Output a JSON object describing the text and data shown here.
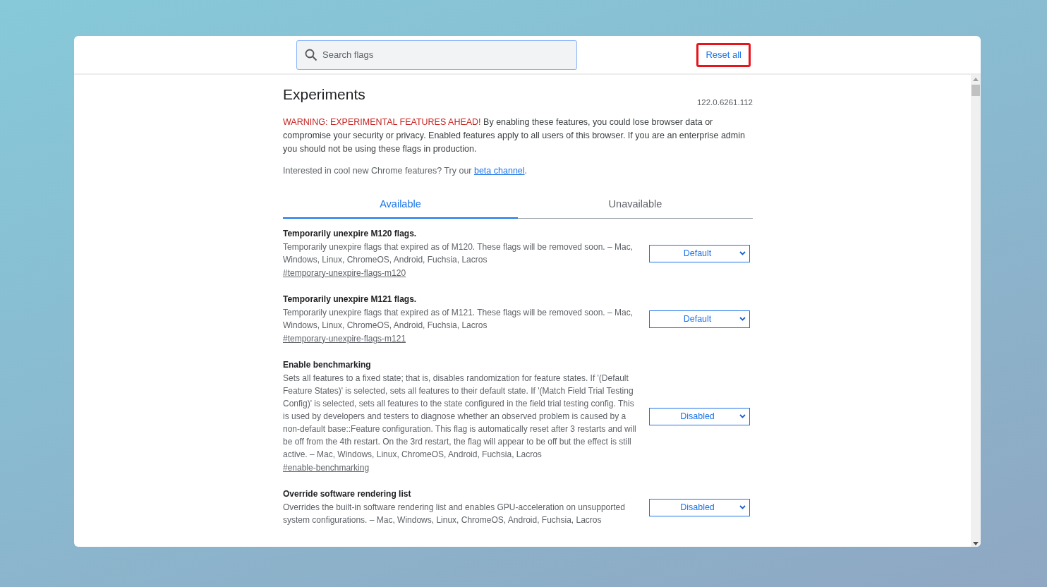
{
  "search": {
    "placeholder": "Search flags"
  },
  "reset_button": {
    "label": "Reset all",
    "highlighted": true
  },
  "title": "Experiments",
  "version": "122.0.6261.112",
  "warning": {
    "label": "WARNING: EXPERIMENTAL FEATURES AHEAD!",
    "text": "By enabling these features, you could lose browser data or compromise your security or privacy. Enabled features apply to all users of this browser. If you are an enterprise admin you should not be using these flags in production."
  },
  "promo": {
    "text": "Interested in cool new Chrome features? Try our",
    "link": "beta channel",
    "after": "."
  },
  "tabs": [
    {
      "label": "Available",
      "selected": true
    },
    {
      "label": "Unavailable",
      "selected": false
    }
  ],
  "flags": [
    {
      "name": "Temporarily unexpire M120 flags.",
      "description": "Temporarily unexpire flags that expired as of M120. These flags will be removed soon. – Mac, Windows, Linux, ChromeOS, Android, Fuchsia, Lacros",
      "link": "#temporary-unexpire-flags-m120",
      "value": "Default"
    },
    {
      "name": "Temporarily unexpire M121 flags.",
      "description": "Temporarily unexpire flags that expired as of M121. These flags will be removed soon. – Mac, Windows, Linux, ChromeOS, Android, Fuchsia, Lacros",
      "link": "#temporary-unexpire-flags-m121",
      "value": "Default"
    },
    {
      "name": "Enable benchmarking",
      "description": "Sets all features to a fixed state; that is, disables randomization for feature states. If '(Default Feature States)' is selected, sets all features to their default state. If '(Match Field Trial Testing Config)' is selected, sets all features to the state configured in the field trial testing config. This is used by developers and testers to diagnose whether an observed problem is caused by a non-default base::Feature configuration. This flag is automatically reset after 3 restarts and will be off from the 4th restart. On the 3rd restart, the flag will appear to be off but the effect is still active. – Mac, Windows, Linux, ChromeOS, Android, Fuchsia, Lacros",
      "link": "#enable-benchmarking",
      "value": "Disabled"
    },
    {
      "name": "Override software rendering list",
      "description": "Overrides the built-in software rendering list and enables GPU-acceleration on unsupported system configurations. – Mac, Windows, Linux, ChromeOS, Android, Fuchsia, Lacros",
      "value": "Disabled"
    }
  ]
}
